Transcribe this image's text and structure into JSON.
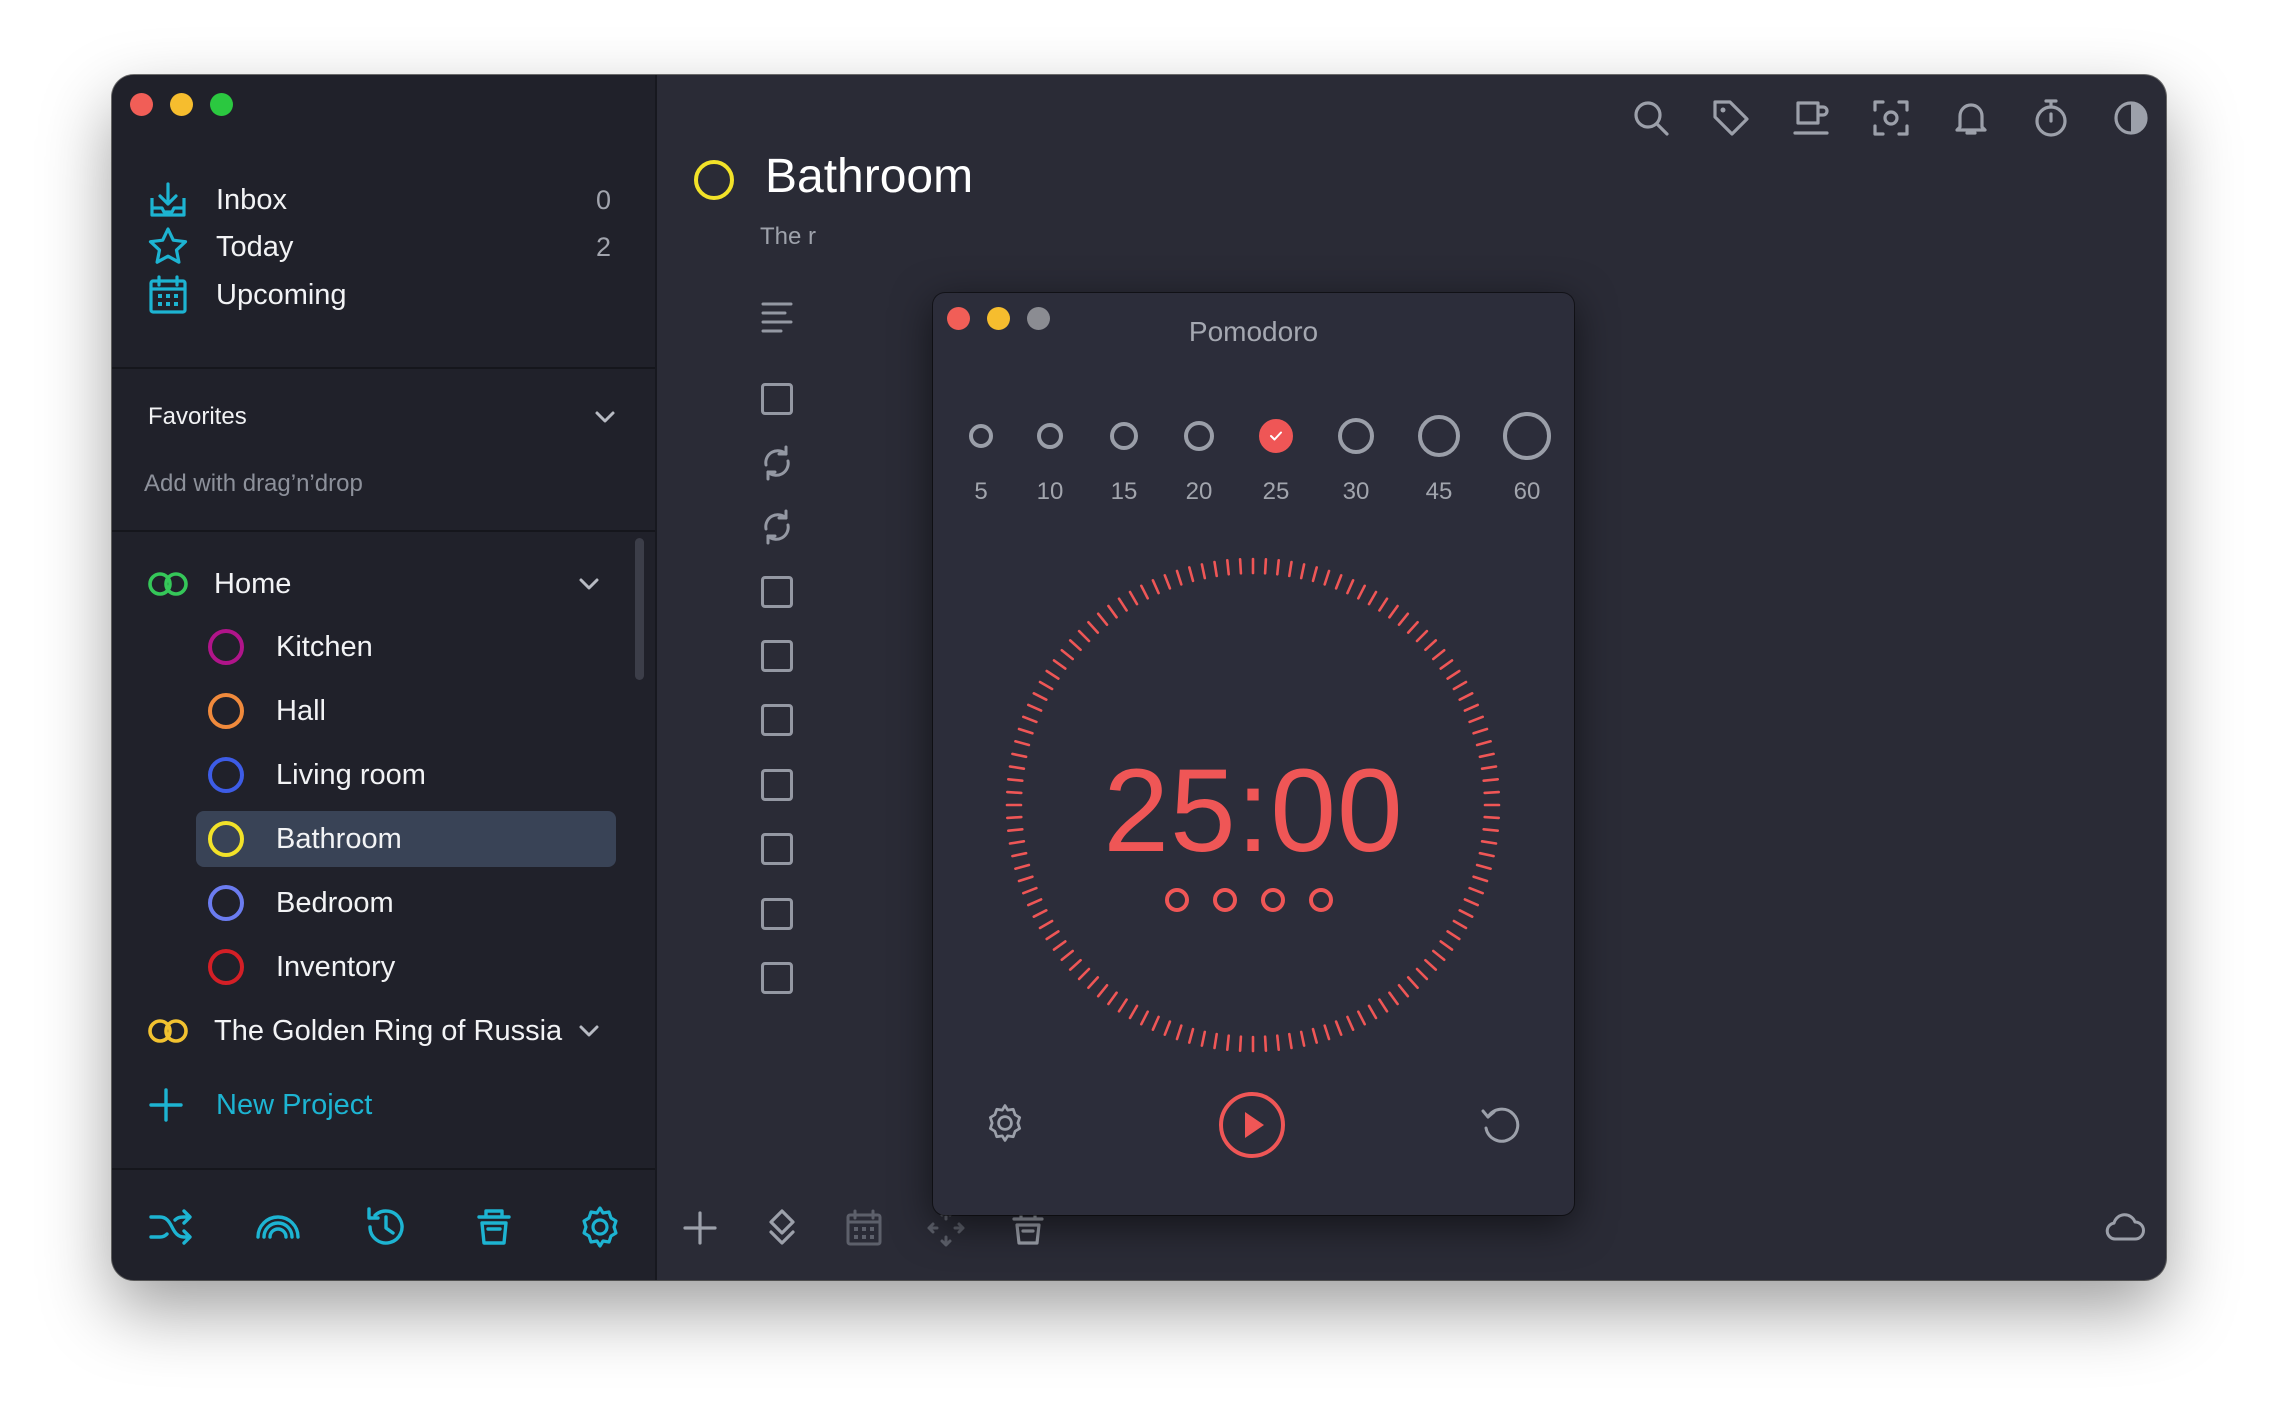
{
  "sidebar": {
    "nav": [
      {
        "label": "Inbox",
        "count": "0",
        "icon": "inbox-icon"
      },
      {
        "label": "Today",
        "count": "2",
        "icon": "star-icon"
      },
      {
        "label": "Upcoming",
        "count": "",
        "icon": "calendar-icon"
      }
    ],
    "favorites": {
      "title": "Favorites",
      "hint": "Add with drag’n’drop"
    },
    "projects": [
      {
        "label": "Home",
        "color": "#35c759",
        "children": [
          {
            "label": "Kitchen",
            "color": "#b0148a"
          },
          {
            "label": "Hall",
            "color": "#f08a3c"
          },
          {
            "label": "Living room",
            "color": "#3d5ce6"
          },
          {
            "label": "Bathroom",
            "color": "#f2e229",
            "selected": true
          },
          {
            "label": "Bedroom",
            "color": "#6b7cf0"
          },
          {
            "label": "Inventory",
            "color": "#d41f26"
          }
        ]
      },
      {
        "label": "The Golden Ring of Russia",
        "color": "#f2c230",
        "children": []
      }
    ],
    "new_project": "New Project",
    "toolbar_icons": [
      "shuffle-icon",
      "rainbow-icon",
      "history-icon",
      "trash-icon",
      "gear-icon"
    ]
  },
  "main": {
    "project_title": "Bathroom",
    "project_color": "#f2e229",
    "description": "The r",
    "top_icons": [
      "search-icon",
      "tag-icon",
      "coffee-icon",
      "focus-icon",
      "bell-icon",
      "stopwatch-icon",
      "contrast-icon",
      "windows-icon"
    ],
    "bottom_icons": [
      "plus-icon",
      "move-icon",
      "calendar-icon",
      "arrows-icon",
      "trash-icon",
      "cloud-icon"
    ]
  },
  "pomodoro": {
    "title": "Pomodoro",
    "durations": [
      "5",
      "10",
      "15",
      "20",
      "25",
      "30",
      "45",
      "60"
    ],
    "selected_duration": "25",
    "time": "25:00",
    "sessions": 4,
    "accent": "#ef5656"
  }
}
